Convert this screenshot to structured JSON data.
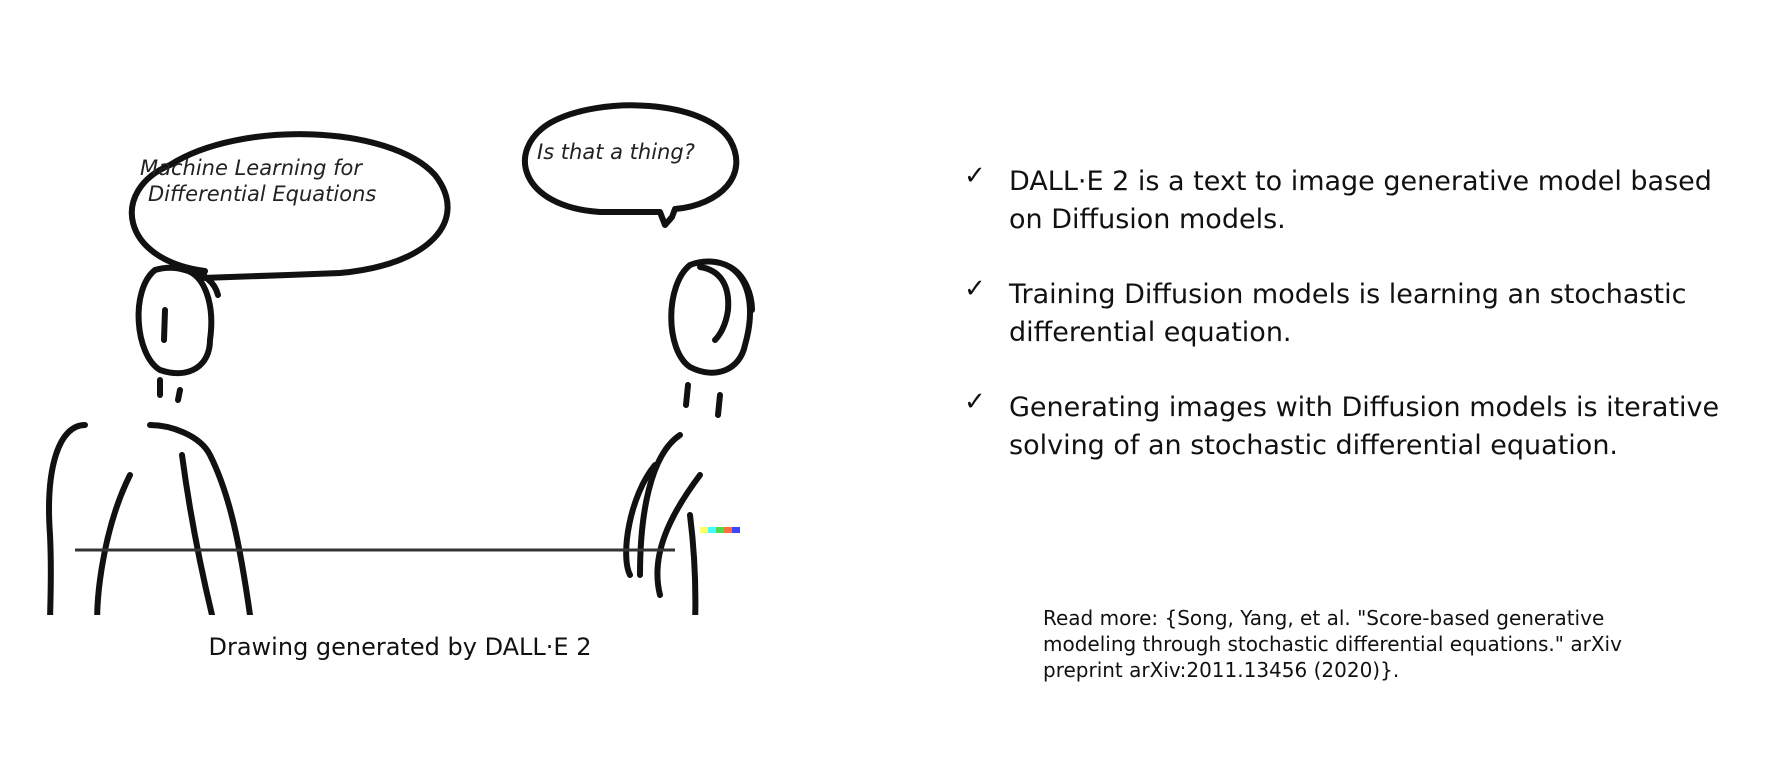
{
  "drawing": {
    "bubble_left_lines": [
      "Machine Learning for",
      "Differential Equations"
    ],
    "bubble_right": "Is that a thing?",
    "caption": "Drawing generated by DALL·E 2"
  },
  "bullets": [
    {
      "icon": "check-icon",
      "symbol": "✓",
      "text": "DALL·E 2 is a text to image generative model based on Diffusion models."
    },
    {
      "icon": "check-icon",
      "symbol": "✓",
      "text": "Training Diffusion models is learning an stochastic differential equation."
    },
    {
      "icon": "check-icon",
      "symbol": "✓",
      "text": "Generating images with Diffusion models is iterative solving of an stochastic differential equation."
    }
  ],
  "reference": "Read more: {Song, Yang, et al. \"Score-based generative modeling through stochastic differential equations.\" arXiv preprint arXiv:2011.13456 (2020)}.",
  "colors": {
    "ink": "#111111",
    "background": "#ffffff"
  }
}
